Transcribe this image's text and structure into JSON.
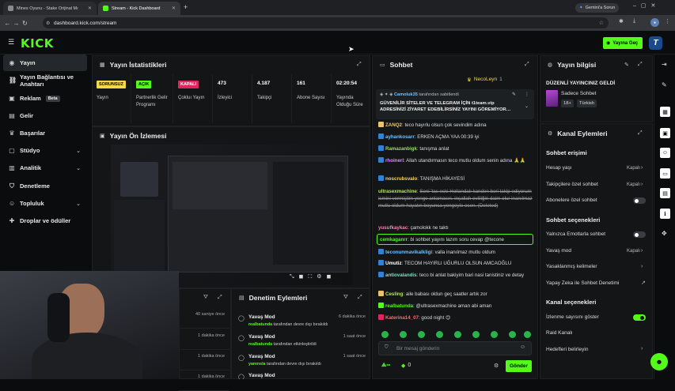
{
  "browser": {
    "tabs": [
      {
        "label": "Mines Oyunu - Stake Orijinal Mı"
      },
      {
        "label": "Stream - Kick Dashboard"
      }
    ],
    "new_tab": "+",
    "gemini": "Gemini'a Sorun",
    "url": "dashboard.kick.com/stream"
  },
  "header": {
    "logo": "KICK",
    "go_live": "Yayına Geç",
    "avatar_letter": "T"
  },
  "sidebar": {
    "items": [
      {
        "label": "Yayın",
        "icon": "broadcast-icon"
      },
      {
        "label": "Yayın Bağlantısı ve Anahtarı",
        "icon": "link-icon"
      },
      {
        "label": "Reklam",
        "icon": "ad-icon",
        "badge": "Beta"
      },
      {
        "label": "Gelir",
        "icon": "money-icon"
      },
      {
        "label": "Başarılar",
        "icon": "trophy-icon"
      },
      {
        "label": "Stüdyo",
        "icon": "studio-icon"
      },
      {
        "label": "Analitik",
        "icon": "analytics-icon"
      },
      {
        "label": "Denetleme",
        "icon": "shield-icon"
      },
      {
        "label": "Topluluk",
        "icon": "community-icon"
      },
      {
        "label": "Droplar ve ödüller",
        "icon": "gift-icon"
      }
    ]
  },
  "stats": {
    "title": "Yayın İstatistikleri",
    "boxes": [
      {
        "tag": "SORUNSUZ",
        "label": "Yayın"
      },
      {
        "tag": "AÇIK",
        "label": "Partnerlik Gelir Programı"
      },
      {
        "tag": "KAPALI",
        "label": "Çokluı Yayın"
      },
      {
        "value": "473",
        "label": "İzleyici"
      },
      {
        "value": "4.187",
        "label": "Takipçi"
      },
      {
        "value": "161",
        "label": "Abone Sayısı"
      },
      {
        "value": "02:20:54",
        "label": "Yayında Olduğu Süre"
      }
    ]
  },
  "preview": {
    "title": "Yayın Ön İzlemesi"
  },
  "timeline": {
    "times": [
      "40 saniye önce",
      "1 dakika önce",
      "1 dakika önce",
      "1 dakika önce"
    ]
  },
  "mod_actions": {
    "title": "Denetim Eylemleri",
    "rows": [
      {
        "name": "Yavaş Mod",
        "user": "realbatunda",
        "text": "tarafından devre dışı bırakıldı",
        "time": "6 dakika önce"
      },
      {
        "name": "Yavaş Mod",
        "user": "realbatunda",
        "text": "tarafından etkinleştirildi",
        "time": "1 saat önce"
      },
      {
        "name": "Yavaş Mod",
        "user": "yarensla",
        "text": "tarafından devre dışı bırakıldı",
        "time": "1 saat önce"
      },
      {
        "name": "Yavaş Mod",
        "user": "",
        "text": "",
        "time": ""
      }
    ]
  },
  "chat": {
    "title": "Sohbet",
    "top_user": "NecoLeyn",
    "top_count": "1",
    "pinned_by": "Camoluk35",
    "pinned_suffix": "tarafından sabitlendi",
    "pinned_text": "GÜVENİLİR SİTELER VE TELEGRAM İÇİN t1team.vip ADRESİNİZİ ZİYARET EDEBİLİRSİNİZ YAYINI GÖREMİYOR…",
    "messages": [
      {
        "user": "ZANQ2",
        "color": "#e9c46a",
        "text": "teco hayırlu olsun çok sevindim adına"
      },
      {
        "user": "ayhankosarr",
        "color": "#6ec1ff",
        "text": "ERKEN AÇMA YAA 00:39 iyi"
      },
      {
        "user": "Ramazanbigk",
        "color": "#9ad86f",
        "text": "tanışma anlat"
      },
      {
        "user": "rhoinerl",
        "color": "#d98cff",
        "text": "Allah utandırmasın teco mutlu oldum senin adına 🙏🙏"
      },
      {
        "user": "noscrubsvalo",
        "color": "#ffd166",
        "text": "TANIŞMA HİKAYESİ"
      },
      {
        "user": "ultrasexmachine",
        "color": "#b6e36a",
        "text": "Seni 'tas eski Hollandalı kanden beri takip ediyorum ismini vermiştim yenge anlamasın. inşallah evliliğin daim olur inanılmaz mutlu oldum hayatın boyunca yengeyle esen. (Deleted)"
      },
      {
        "user": "yusufkaykac",
        "color": "#ff7eb6",
        "text": "çamolokk ne taktı"
      },
      {
        "user": "cemkaganrr",
        "color": "#53fc18",
        "text": "bi sohbet yayını lazım soru cevap @tecone"
      },
      {
        "user": "teconunmavikalkligi",
        "color": "#6ec1ff",
        "text": "valla inanılmaz mutlu oldum"
      },
      {
        "user": "Umutiz",
        "color": "#ffffff",
        "text": "TECOM HAYIRLI UĞURLU OLSUN AMCAOĞLU"
      },
      {
        "user": "antiovalandis",
        "color": "#7ee0c3",
        "text": "teco bi anlat bakiyim bari nasi tanistiniz ve detay"
      },
      {
        "user": "Cesling",
        "color": "#b6e36a",
        "text": "aile babası oldun geç saatler artık zor"
      },
      {
        "user": "realbatunda",
        "color": "#53fc18",
        "text": "@ultrasexmachine aman abi aman"
      },
      {
        "user": "Katerina14_07",
        "color": "#ff6b6b",
        "text": "good night 😊"
      }
    ],
    "input_placeholder": "Bir mesaj gönderin",
    "points": "0",
    "send": "Gönder"
  },
  "stream_info": {
    "title": "Yayın bilgisi",
    "stream_title": "DÜZENLİ YAYINCINIZ GELDİ",
    "category": "Sadece Sohbet",
    "tags": [
      "18+",
      "Türkish"
    ]
  },
  "channel_actions": {
    "title": "Kanal Eylemleri",
    "sec_access": "Sohbet erişimi",
    "account_age": "Hesap yaşı",
    "account_age_val": "Kapalı",
    "followers_chat": "Takipçilere özel sohbet",
    "followers_chat_val": "Kapalı",
    "subs_chat": "Abonelere özel sohbet",
    "sec_options": "Sohbet seçenekleri",
    "emote_chat": "Yalnızca Emotlarla sohbet",
    "slow_mode": "Yavaş mod",
    "slow_mode_val": "Kapalı",
    "banned_words": "Yasaklanmış kelimeler",
    "ai_mod": "Yapay Zeka ile Sohbet Denetimi",
    "sec_channel": "Kanal seçenekleri",
    "show_viewers": "İzlenme sayısını göster",
    "raid": "Raid Kanalı",
    "hedef": "Hedefleri belirleyin"
  },
  "colors": {
    "accent": "#53fc18",
    "bg": "#0b0c0d",
    "panel": "#131517"
  }
}
